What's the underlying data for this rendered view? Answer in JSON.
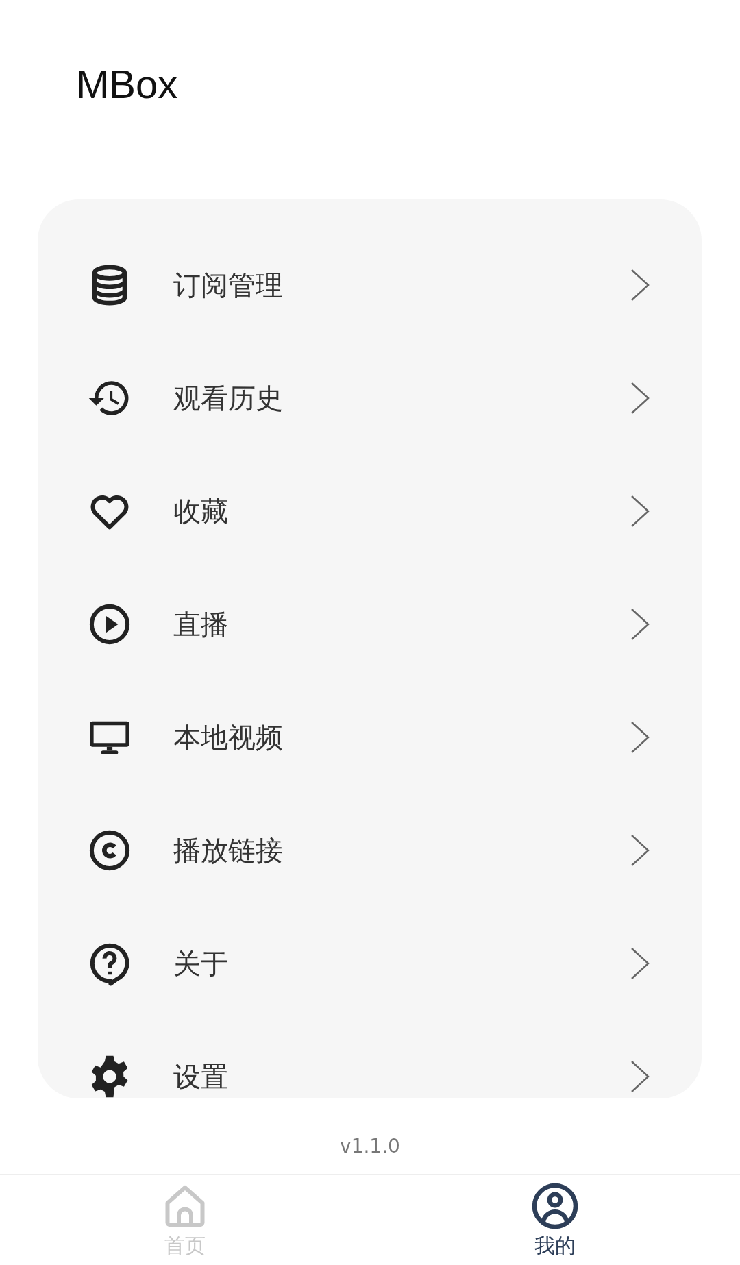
{
  "app_title": "MBox",
  "menu": [
    {
      "kind": "database",
      "label": "订阅管理"
    },
    {
      "kind": "history",
      "label": "观看历史"
    },
    {
      "kind": "heart",
      "label": "收藏"
    },
    {
      "kind": "play",
      "label": "直播"
    },
    {
      "kind": "monitor",
      "label": "本地视频"
    },
    {
      "kind": "copyright",
      "label": "播放链接"
    },
    {
      "kind": "help",
      "label": "关于"
    },
    {
      "kind": "gear",
      "label": "设置"
    }
  ],
  "version": "v1.1.0",
  "tabs": [
    {
      "kind": "home",
      "label": "首页",
      "selected": false
    },
    {
      "kind": "user",
      "label": "我的",
      "selected": true
    }
  ]
}
